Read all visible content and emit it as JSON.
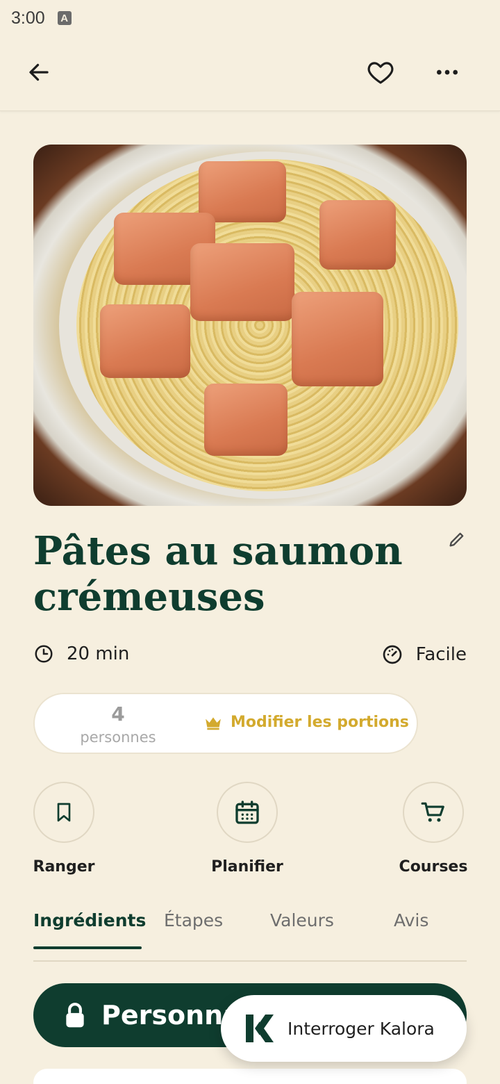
{
  "status_bar": {
    "time": "3:00",
    "badge": "A"
  },
  "recipe": {
    "title": "Pâtes au saumon crémeuses",
    "time": "20 min",
    "difficulty": "Facile",
    "portions_count": "4",
    "portions_unit": "personnes",
    "modify_portions_label": "Modifier les portions"
  },
  "actions": [
    {
      "label": "Ranger",
      "icon": "bookmark-icon"
    },
    {
      "label": "Planifier",
      "icon": "calendar-icon"
    },
    {
      "label": "Courses",
      "icon": "cart-icon"
    }
  ],
  "tabs": [
    "Ingrédients",
    "Étapes",
    "Valeurs",
    "Avis"
  ],
  "active_tab": "Ingrédients",
  "personalize_label": "Personna",
  "kalora_label": "Interroger Kalora",
  "colors": {
    "primary": "#0f3d2f",
    "accent_gold": "#d3aa2e",
    "background": "#f6efdf"
  }
}
